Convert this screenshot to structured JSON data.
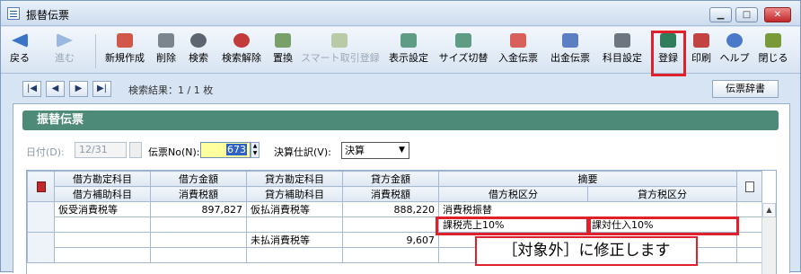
{
  "window": {
    "title": "振替伝票",
    "min_icon": "minimize-icon",
    "max_icon": "maximize-icon",
    "close_icon": "close-icon",
    "close_glyph": "✕",
    "min_glyph": "▁",
    "max_glyph": "□"
  },
  "toolbar": {
    "back": "戻る",
    "forward": "進む",
    "new": "新規作成",
    "delete": "削除",
    "search": "検索",
    "search_clear": "検索解除",
    "replace": "置換",
    "smart_entry": "スマート取引登録",
    "display_settings": "表示設定",
    "size_toggle": "サイズ切替",
    "deposit_slip": "入金伝票",
    "payment_slip": "出金伝票",
    "account_settings": "科目設定",
    "register": "登録",
    "print": "印刷",
    "help": "ヘルプ",
    "close": "閉じる"
  },
  "nav": {
    "first": "|◀",
    "prev": "◀",
    "next": "▶",
    "last": "▶|",
    "search_result": "検索結果：1 / 1 枚",
    "dictionary": "伝票辞書"
  },
  "panel": {
    "heading": "振替伝票"
  },
  "form": {
    "date_label": "日付(D):",
    "date_value": "12/31",
    "slip_no_label": "伝票No(N):",
    "slip_no_value": "673",
    "closing_label": "決算仕訳(V):",
    "closing_value": "決算"
  },
  "table": {
    "header1": [
      "借方勘定科目",
      "借方金額",
      "貸方勘定科目",
      "貸方金額",
      "摘要"
    ],
    "header2": [
      "借方補助科目",
      "消費税額",
      "貸方補助科目",
      "消費税額",
      "借方税区分",
      "貸方税区分"
    ],
    "rows": [
      {
        "debit_account": "仮受消費税等",
        "debit_amount": "897,827",
        "credit_account": "仮払消費税等",
        "credit_amount": "888,220",
        "memo": "消費税振替"
      },
      {
        "debit_tax": "課税売上10%",
        "credit_tax": "課対仕入10%"
      },
      {
        "credit_account": "未払消費税等",
        "credit_amount": "9,607"
      }
    ]
  },
  "callout": "［対象外］に修正します",
  "colors": {
    "accent_red": "#e0202a",
    "panel_header": "#4d8a78",
    "slip_no_bg": "#ffff9e"
  }
}
